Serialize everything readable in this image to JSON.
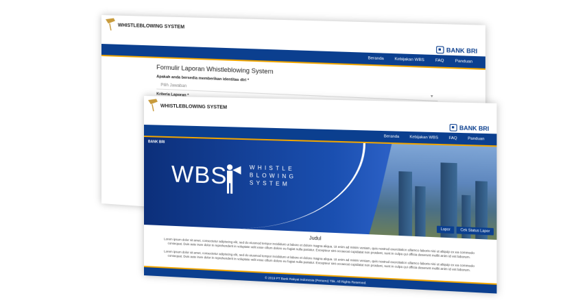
{
  "app": {
    "title": "WHISTLEBLOWING SYSTEM",
    "brand": "BANK BRI"
  },
  "nav": {
    "items": [
      "Beranda",
      "Kebijakan WBS",
      "FAQ",
      "Panduan"
    ]
  },
  "form": {
    "heading": "Formulir Laporan Whistleblowing System",
    "identity_label": "Apakah anda bersedia memberikan identitas diri *",
    "identity_placeholder": "Pilih Jawaban",
    "criteria_label": "Kriteria Laporan *"
  },
  "hero": {
    "logo_small": "BANK BRI",
    "wbs": "WBS",
    "subtitle_lines": [
      "WHISTLE",
      "BLOWING",
      "SYSTEM"
    ],
    "buttons": [
      "Lapor",
      "Cek Status Lapor"
    ]
  },
  "content": {
    "title": "Judul",
    "paragraph1": "Lorem ipsum dolor sit amet, consectetur adipiscing elit, sed do eiusmod tempor incididunt ut labore et dolore magna aliqua. Ut enim ad minim veniam, quis nostrud exercitation ullamco laboris nisi ut aliquip ex ea commodo consequat. Duis aute irure dolor in reprehenderit in voluptate velit esse cillum dolore eu fugiat nulla pariatur. Excepteur sint occaecat cupidatat non proident, sunt in culpa qui officia deserunt mollit anim id est laborum.",
    "paragraph2": "Lorem ipsum dolor sit amet, consectetur adipiscing elit, sed do eiusmod tempor incididunt ut labore et dolore magna aliqua. Ut enim ad minim veniam, quis nostrud exercitation ullamco laboris nisi ut aliquip ex ea commodo consequat. Duis aute irure dolor in reprehenderit in voluptate velit esse cillum dolore eu fugiat nulla pariatur. Excepteur sint occaecat cupidatat non proident, sunt in culpa qui officia deserunt mollit anim id est laborum."
  },
  "footer": {
    "text": "© 2019 PT Bank Rakyat Indonesia (Persero) Tbk. All Rights Reserved."
  },
  "colors": {
    "primary": "#0b3f8f",
    "accent": "#f0a500"
  }
}
